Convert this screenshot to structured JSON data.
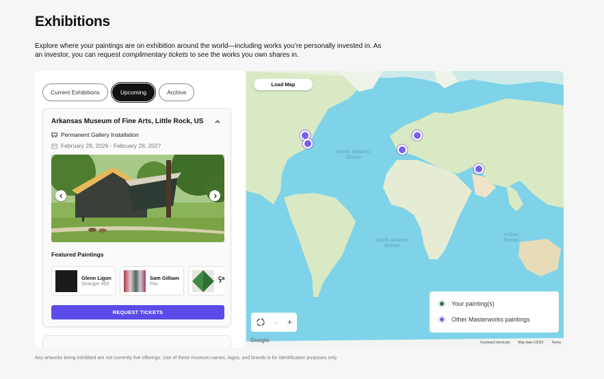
{
  "page": {
    "title": "Exhibitions",
    "intro_part1": "Explore where your paintings are on exhibition around the world—including works you’re personally invested in. As an investor, you can request ",
    "intro_em": "complimentary tickets",
    "intro_part2": " to see the works you own shares in.",
    "disclaimer": "Any artworks being exhibited are not currently live offerings. Use of these museum names, logos, and brands is for identification purposes only."
  },
  "tabs": [
    {
      "label": "Current Exhibitions",
      "active": false
    },
    {
      "label": "Upcoming",
      "active": true
    },
    {
      "label": "Archive",
      "active": false
    }
  ],
  "exhibition": {
    "title": "Arkansas Museum of Fine Arts, Little Rock, US",
    "type": "Permanent Gallery Installation",
    "dates": "February 28, 2026 - February 28, 2027",
    "featured_heading": "Featured Paintings",
    "paintings": [
      {
        "artist": "Glenn Ligon",
        "work": "Stranger #55"
      },
      {
        "artist": "Sam Gilliam",
        "work": "Pac"
      },
      {
        "artist": "Car",
        "work": ""
      }
    ],
    "request_label": "REQUEST TICKETS"
  },
  "map": {
    "load_label": "Load Map",
    "ocean_labels": [
      "North Atlantic Ocean",
      "South Atlantic Ocean",
      "Indian Ocean"
    ],
    "legend": [
      {
        "label": "Your painting(s)",
        "color": "#1f7a3a"
      },
      {
        "label": "Other Masterworks paintings",
        "color": "#7b5cf0"
      }
    ],
    "zoom_minus": "-",
    "zoom_plus": "+",
    "attribution": [
      "Keyboard shortcuts",
      "Map data ©2023",
      "Terms"
    ],
    "google": "Google"
  },
  "colors": {
    "accent": "#5b4be8",
    "marker": "#7b5cf0",
    "ocean": "#7fd3e8",
    "land": "#d9e9c4"
  }
}
